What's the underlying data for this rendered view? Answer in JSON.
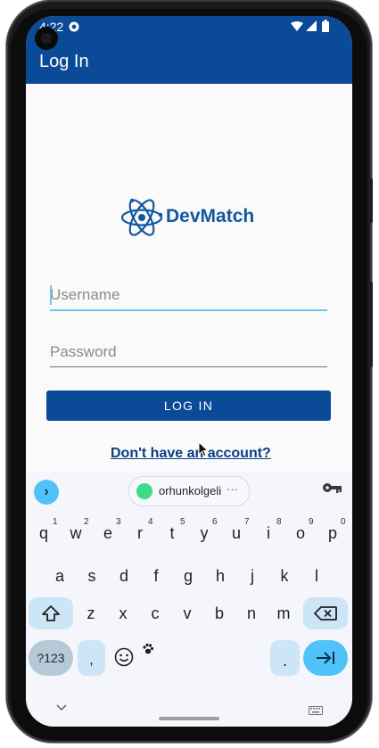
{
  "status": {
    "time": "4:22"
  },
  "app_bar": {
    "title": "Log In"
  },
  "logo": {
    "text": "DevMatch"
  },
  "form": {
    "username_placeholder": "Username",
    "password_placeholder": "Password",
    "login_label": "LOG IN",
    "signup_link": "Don't have an account?"
  },
  "keyboard": {
    "suggestion_chip": "orhunkolgeli",
    "row1": [
      "q",
      "w",
      "e",
      "r",
      "t",
      "y",
      "u",
      "i",
      "o",
      "p"
    ],
    "row1_hints": [
      "1",
      "2",
      "3",
      "4",
      "5",
      "6",
      "7",
      "8",
      "9",
      "0"
    ],
    "row2": [
      "a",
      "s",
      "d",
      "f",
      "g",
      "h",
      "j",
      "k",
      "l"
    ],
    "row3": [
      "z",
      "x",
      "c",
      "v",
      "b",
      "n",
      "m"
    ],
    "symbols_label": "?123",
    "comma": ",",
    "period": "."
  },
  "colors": {
    "brand_blue": "#0a4a97",
    "accent_cyan": "#4fc3f7",
    "key_light_blue": "#cde6f7"
  }
}
